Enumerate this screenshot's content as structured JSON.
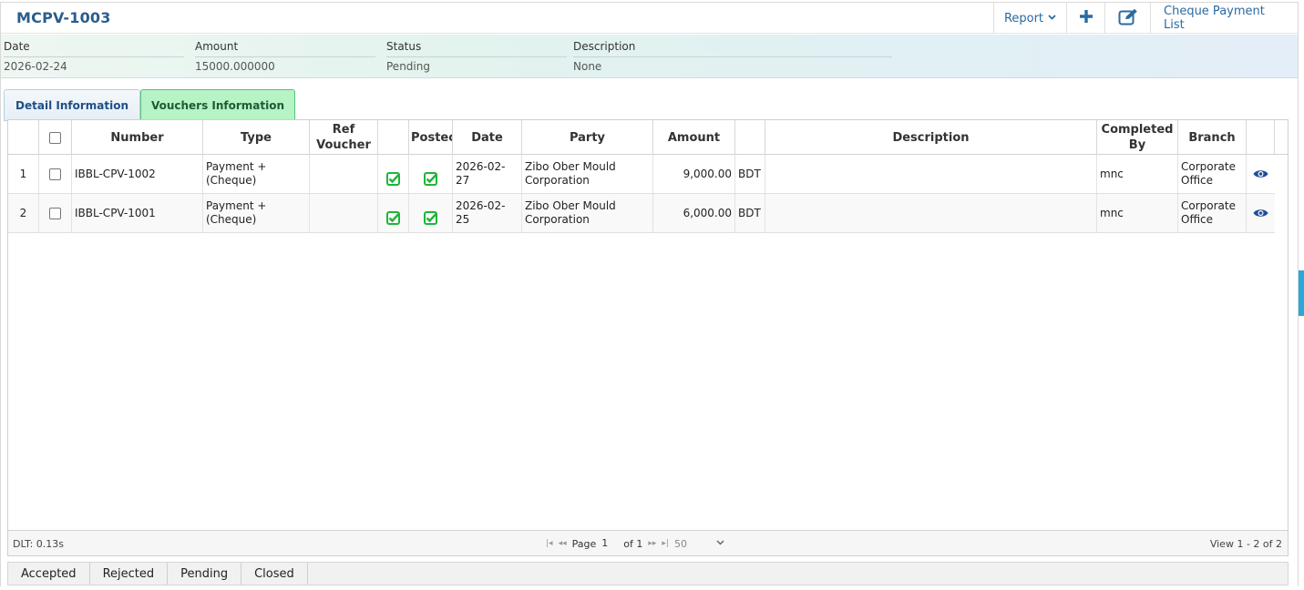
{
  "header": {
    "title": "MCPV-1003",
    "report_label": "Report",
    "list_label": "Cheque Payment List",
    "icons": {
      "caret": "chevron-down-icon",
      "add": "plus-icon",
      "edit": "edit-icon"
    }
  },
  "summary": {
    "date_label": "Date",
    "date_value": "2026-02-24",
    "amount_label": "Amount",
    "amount_value": "15000.000000",
    "status_label": "Status",
    "status_value": "Pending",
    "description_label": "Description",
    "description_value": "None"
  },
  "tabs": [
    {
      "label": "Detail Information",
      "active": false
    },
    {
      "label": "Vouchers Information",
      "active": true
    }
  ],
  "grid": {
    "columns": {
      "number": "Number",
      "type": "Type",
      "ref_voucher": "Ref Voucher",
      "posted": "Postec",
      "date": "Date",
      "party": "Party",
      "amount": "Amount",
      "description": "Description",
      "completed_by": "Completed By",
      "branch": "Branch"
    },
    "rows": [
      {
        "index": "1",
        "number": "IBBL-CPV-1002",
        "type": "Payment + (Cheque)",
        "ref_voucher": "",
        "date": "2026-02-27",
        "party": "Zibo Ober Mould Corporation",
        "amount": "9,000.00",
        "currency": "BDT",
        "description": "",
        "completed_by": "mnc",
        "branch": "Corporate Office"
      },
      {
        "index": "2",
        "number": "IBBL-CPV-1001",
        "type": "Payment + (Cheque)",
        "ref_voucher": "",
        "date": "2026-02-25",
        "party": "Zibo Ober Mould Corporation",
        "amount": "6,000.00",
        "currency": "BDT",
        "description": "",
        "completed_by": "mnc",
        "branch": "Corporate Office"
      }
    ],
    "footer": {
      "dlt": "DLT: 0.13s",
      "page_label": "Page",
      "page_value": "1",
      "of_label": "of 1",
      "page_size": "50",
      "view_info": "View 1 - 2 of 2"
    }
  },
  "status_buttons": [
    "Accepted",
    "Rejected",
    "Pending",
    "Closed"
  ],
  "colors": {
    "accent": "#2b6aa1",
    "active_tab": "#b6f3c5",
    "check": "#1eb53a"
  }
}
